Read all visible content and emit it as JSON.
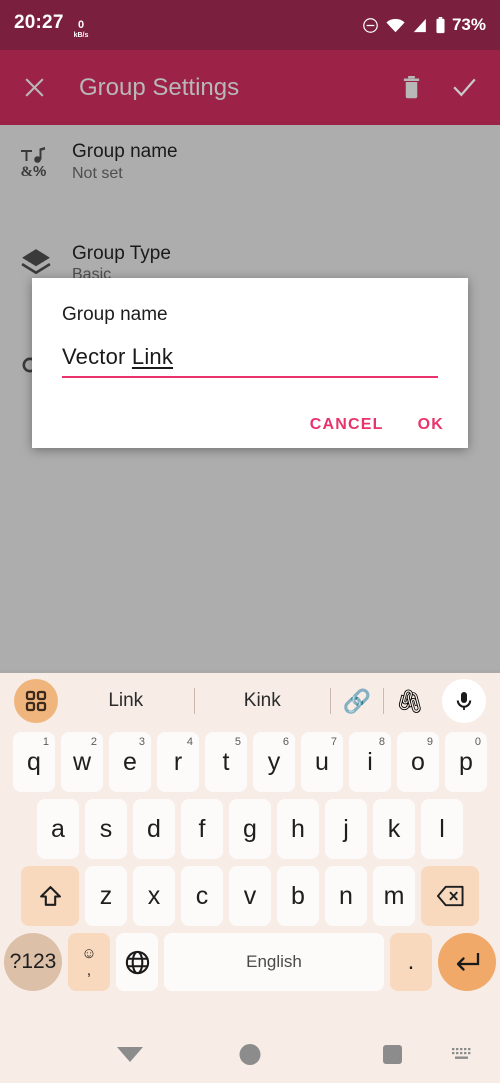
{
  "status_bar": {
    "clock": "20:27",
    "net_speed_value": "0",
    "net_speed_unit": "kB/s",
    "battery_percent": "73%",
    "icons": [
      "do-not-disturb-icon",
      "wifi-icon",
      "signal-icon",
      "battery-icon"
    ],
    "background_color": "#7A1F3D",
    "text_color": "#FFFFFF"
  },
  "app_bar": {
    "title": "Group Settings",
    "close_icon": "close-icon",
    "delete_icon": "trash-icon",
    "save_icon": "check-icon",
    "background_color": "#9C2247",
    "title_color": "#B8B8B8"
  },
  "settings_list": {
    "items": [
      {
        "icon": "text-symbols-icon",
        "title": "Group name",
        "subtitle": "Not set"
      },
      {
        "icon": "layers-icon",
        "title": "Group Type",
        "subtitle": "Basic"
      }
    ],
    "dim_overlay_color": "#ADADAD"
  },
  "dialog": {
    "title": "Group name",
    "input_value_plain": "Vector ",
    "input_value_composing": "Link",
    "input_full_value": "Vector Link",
    "underline_color": "#E8336D",
    "cancel_label": "CANCEL",
    "ok_label": "OK",
    "accent_color": "#E8336D",
    "background_color": "#FFFFFF"
  },
  "keyboard": {
    "background_color": "#F7ECE6",
    "key_color": "#FDFBFA",
    "accent_key_color": "#F9D9BE",
    "suggestion_bar": {
      "grid_icon": "apps-grid-icon",
      "suggestions": [
        "Link",
        "Kink"
      ],
      "emoji_suggestions": [
        "🔗",
        "🖇"
      ],
      "mic_icon": "microphone-icon"
    },
    "row1": [
      {
        "letter": "q",
        "number": "1"
      },
      {
        "letter": "w",
        "number": "2"
      },
      {
        "letter": "e",
        "number": "3"
      },
      {
        "letter": "r",
        "number": "4"
      },
      {
        "letter": "t",
        "number": "5"
      },
      {
        "letter": "y",
        "number": "6"
      },
      {
        "letter": "u",
        "number": "7"
      },
      {
        "letter": "i",
        "number": "8"
      },
      {
        "letter": "o",
        "number": "9"
      },
      {
        "letter": "p",
        "number": "0"
      }
    ],
    "row2": [
      "a",
      "s",
      "d",
      "f",
      "g",
      "h",
      "j",
      "k",
      "l"
    ],
    "row3_letters": [
      "z",
      "x",
      "c",
      "v",
      "b",
      "n",
      "m"
    ],
    "shift_icon": "shift-arrow-icon",
    "backspace_icon": "backspace-icon",
    "row4": {
      "symbols_label": "?123",
      "emoji_top": "☺",
      "emoji_bottom": ",",
      "globe_icon": "globe-language-icon",
      "space_label": "English",
      "period_label": ".",
      "enter_icon": "enter-return-icon"
    }
  },
  "nav_bar": {
    "back_icon": "hide-keyboard-down-arrow-icon",
    "home_icon": "home-circle-icon",
    "recents_icon": "recents-square-icon",
    "switch_keyboard_icon": "keyboard-switch-icon",
    "background_color": "#F7ECE6",
    "icon_color": "#8C8C8C"
  }
}
